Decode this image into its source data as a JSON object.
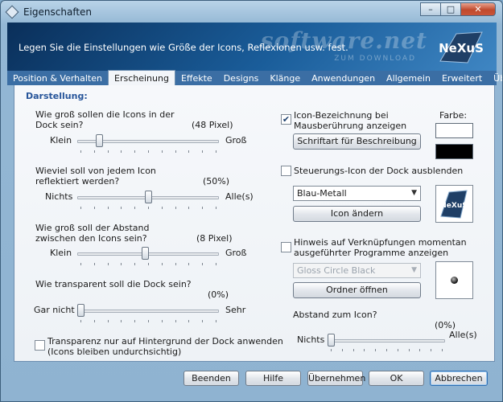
{
  "window": {
    "title": "Eigenschaften",
    "min": "–",
    "max": "□",
    "close": "✕"
  },
  "header": {
    "description": "Legen Sie die Einstellungen wie Größe der Icons, Reflexionen usw. fest.",
    "watermark": "software.net",
    "watermark_sub": "ZUM DOWNLOAD",
    "logo_text": "NeXuS"
  },
  "tabs": [
    {
      "label": "Position & Verhalten"
    },
    {
      "label": "Erscheinung"
    },
    {
      "label": "Effekte"
    },
    {
      "label": "Designs"
    },
    {
      "label": "Klänge"
    },
    {
      "label": "Anwendungen"
    },
    {
      "label": "Allgemein"
    },
    {
      "label": "Erweitert"
    },
    {
      "label": "Über..."
    }
  ],
  "active_tab": "Erscheinung",
  "section_title": "Darstellung:",
  "sliders": {
    "size": {
      "question_1": "Wie groß sollen die Icons in der",
      "question_2": "Dock sein?",
      "value": "(48 Pixel)",
      "min": "Klein",
      "max": "Groß",
      "fraction": 0.14
    },
    "reflection": {
      "question_1": "Wieviel soll von jedem Icon",
      "question_2": "reflektiert werden?",
      "value": "(50%)",
      "min": "Nichts",
      "max": "Alle(s)",
      "fraction": 0.5
    },
    "spacing": {
      "question_1": "Wie groß soll der Abstand",
      "question_2": "zwischen den Icons sein?",
      "value": "(8 Pixel)",
      "min": "Klein",
      "max": "Groß",
      "fraction": 0.48
    },
    "transparency": {
      "question_1": "Wie transparent soll die Dock sein?",
      "value": "(0%)",
      "min": "Gar nicht",
      "max": "Sehr",
      "fraction": 0.0
    },
    "icon_distance": {
      "question_1": "Abstand zum Icon?",
      "value": "(0%)",
      "min": "Nichts",
      "max": "Alle(s)",
      "fraction": 0.0
    }
  },
  "checkboxes": {
    "transparency_bg": {
      "label_1": "Transparenz nur auf Hintergrund der Dock anwenden",
      "label_2": "(Icons bleiben undurchsichtig)",
      "checked": false
    },
    "hover_label": {
      "label_1": "Icon-Bezeichnung bei",
      "label_2": "Mausberührung anzeigen",
      "checked": true,
      "mark": "✔"
    },
    "hide_controls": {
      "label_1": "Steuerungs-Icon der Dock ausblenden",
      "checked": false
    },
    "shortcut_hint": {
      "label_1": "Hinweis auf Verknüpfungen momentan",
      "label_2": "ausgeführter Programme anzeigen",
      "checked": false
    }
  },
  "color_label": "Farbe:",
  "colors": {
    "fg": "#ffffff",
    "bg": "#000000",
    "accent": "#27559a"
  },
  "buttons": {
    "font": "Schriftart für Beschreibung",
    "change_icon": "Icon ändern",
    "open_folder": "Ordner öffnen"
  },
  "selects": {
    "style": {
      "value": "Blau-Metall",
      "arrow": "▼"
    },
    "indicator": {
      "value": "Gloss Circle Black",
      "arrow": "▼"
    }
  },
  "footer": {
    "quit": "Beenden",
    "help": "Hilfe",
    "apply": "Übernehmen",
    "ok": "OK",
    "cancel": "Abbrechen"
  }
}
